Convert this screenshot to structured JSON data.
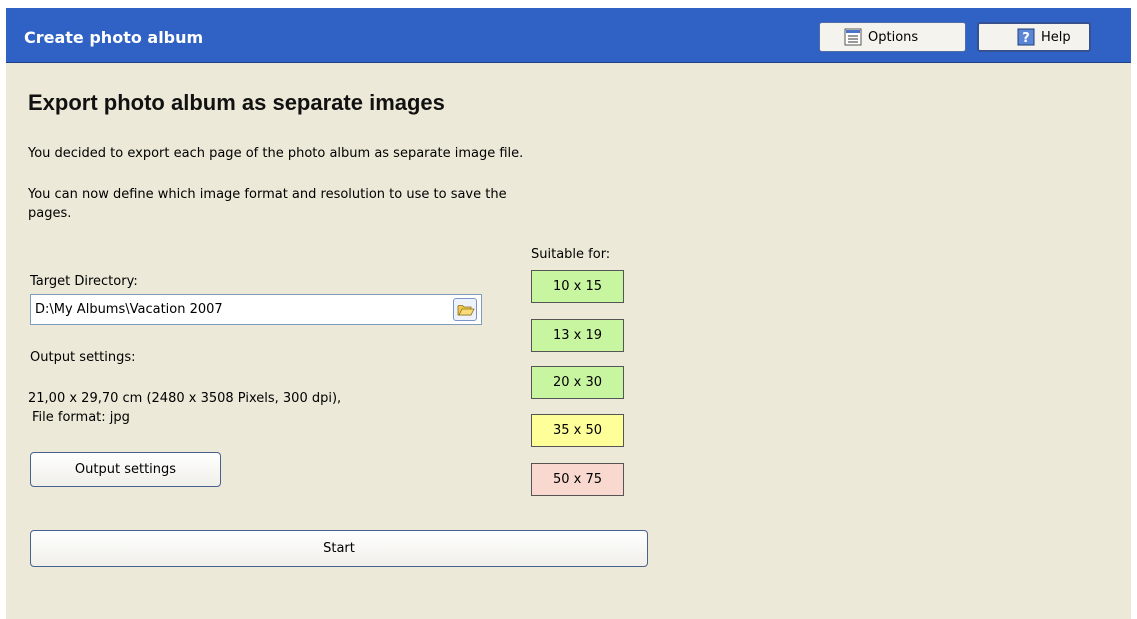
{
  "window": {
    "title": "Create photo album"
  },
  "toolbar": {
    "options_label": "Options",
    "help_label": "Help"
  },
  "page": {
    "heading": "Export photo album as separate images",
    "intro": "You decided to export each page of the photo album as separate image file.",
    "define_line1": "You can now define which image format and resolution to use to save the",
    "define_line2": "pages.",
    "target_label": "Target Directory:",
    "target_value": "D:\\My Albums\\Vacation 2007",
    "output_label": "Output settings:",
    "output_line1": "21,00 x 29,70 cm (2480 x 3508 Pixels, 300 dpi),",
    "output_line2": "File format: jpg",
    "output_button": "Output settings",
    "start_button": "Start"
  },
  "suitable": {
    "label": "Suitable for:",
    "sizes": [
      {
        "label": "10 x 15",
        "color": "#C8F5A0"
      },
      {
        "label": "13 x 19",
        "color": "#C8F5A0"
      },
      {
        "label": "20 x 30",
        "color": "#C8F5A0"
      },
      {
        "label": "35 x 50",
        "color": "#FFFF99"
      },
      {
        "label": "50 x 75",
        "color": "#F9D9CF"
      }
    ]
  },
  "colors": {
    "titlebar": "#2F62C4",
    "panel": "#ECE9D8"
  },
  "icons": {
    "options": "list-icon",
    "help": "question-icon",
    "browse": "folder-icon"
  }
}
